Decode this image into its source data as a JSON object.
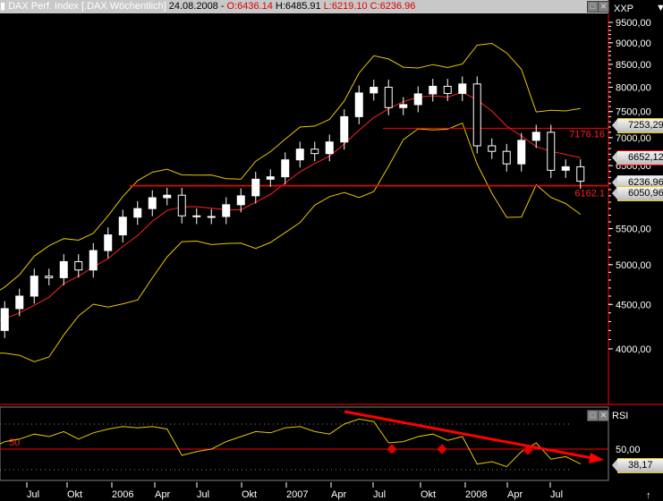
{
  "header": {
    "name": "DAX Perf. Index [.DAX  Wöchentlich]",
    "date": "24.08.2008 -",
    "open": "O:6436.14",
    "high": "H:6485.91",
    "low": "L:6219.10",
    "close": "C:6236.96"
  },
  "axis_labels": {
    "price_unit": "XXP",
    "rsi": "RSI"
  },
  "colors": {
    "candle": "#ffffff",
    "ma": "#ff2020",
    "bands": "#e8c800",
    "rsi": "#e8c800",
    "lines": "#ff0000",
    "axis": "#ff0000"
  },
  "chart_data": [
    {
      "type": "candlestick",
      "scale": "log",
      "ylim": [
        3800,
        9700
      ],
      "yticks": [
        "9500,00",
        "9000,00",
        "8500,00",
        "8000,00",
        "7500,00",
        "7000,00",
        "6500,00",
        "5500,00",
        "5000,00",
        "4500,00",
        "4000,00"
      ],
      "ytick_values": [
        9500,
        9000,
        8500,
        8000,
        7500,
        7000,
        6500,
        5500,
        5000,
        4500,
        4000
      ],
      "xticks": [
        "Jul",
        "Okt",
        "2006",
        "Apr",
        "Jul",
        "Okt",
        "2007",
        "Apr",
        "Jul",
        "Okt",
        "2008",
        "Apr",
        "Jul"
      ],
      "months": [
        "2005-03",
        "2005-04",
        "2005-05",
        "2005-06",
        "2005-07",
        "2005-08",
        "2005-09",
        "2005-10",
        "2005-11",
        "2005-12",
        "2006-01",
        "2006-02",
        "2006-03",
        "2006-04",
        "2006-05",
        "2006-06",
        "2006-07",
        "2006-08",
        "2006-09",
        "2006-10",
        "2006-11",
        "2006-12",
        "2007-01",
        "2007-02",
        "2007-03",
        "2007-04",
        "2007-05",
        "2007-06",
        "2007-07",
        "2007-08",
        "2007-09",
        "2007-10",
        "2007-11",
        "2007-12",
        "2008-01",
        "2008-02",
        "2008-03",
        "2008-04",
        "2008-05",
        "2008-06",
        "2008-07",
        "2008-08"
      ],
      "close": [
        4350,
        4200,
        4450,
        4600,
        4850,
        4830,
        5040,
        4930,
        5190,
        5410,
        5670,
        5800,
        5970,
        6010,
        5690,
        5680,
        5680,
        5860,
        6000,
        6270,
        6310,
        6600,
        6790,
        6710,
        6920,
        7400,
        7880,
        8000,
        7580,
        7640,
        7860,
        8020,
        7870,
        8070,
        6850,
        6750,
        6530,
        6950,
        7100,
        6420,
        6480,
        6237
      ],
      "levels": [
        {
          "label": "7176.16",
          "value": 7176.16
        },
        {
          "label": "6162.1",
          "value": 6162.1
        }
      ],
      "price_tags": [
        {
          "label": "7253,29",
          "value": 7253.29,
          "border": "#e8c800"
        },
        {
          "label": "6652,12",
          "value": 6652.12,
          "border": "#ff0000"
        },
        {
          "label": "6236,96",
          "value": 6236.96,
          "border": "#cccccc"
        },
        {
          "label": "6050,96",
          "value": 6050.96,
          "border": "#e8c800"
        }
      ]
    },
    {
      "type": "line",
      "name": "RSI",
      "ylim": [
        20,
        85
      ],
      "ref_label": "50",
      "ytick": "50,00",
      "last_tag": "38,17",
      "values": [
        55,
        50,
        56,
        58,
        62,
        60,
        64,
        58,
        63,
        66,
        68,
        67,
        68,
        66,
        45,
        48,
        50,
        56,
        60,
        64,
        63,
        67,
        68,
        64,
        62,
        70,
        74,
        72,
        55,
        56,
        60,
        62,
        57,
        60,
        38,
        40,
        36,
        48,
        55,
        42,
        44,
        38.17
      ]
    }
  ]
}
